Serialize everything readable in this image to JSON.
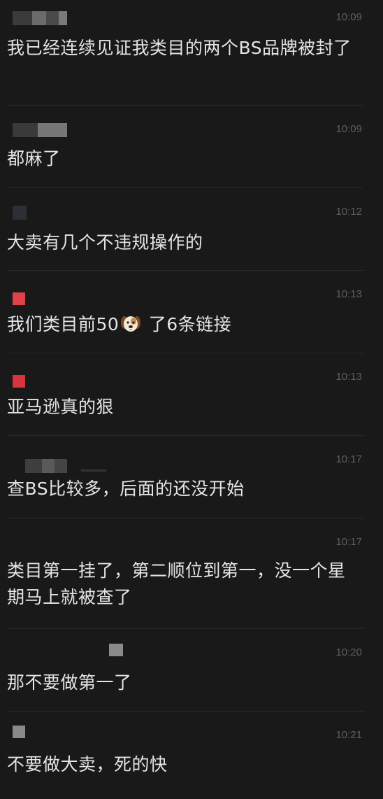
{
  "messages": [
    {
      "time": "10:09",
      "text": "我已经连续见证我类目的两个BS品牌被封了"
    },
    {
      "time": "10:09",
      "text": "都麻了"
    },
    {
      "time": "10:12",
      "text": "大卖有几个不违规操作的"
    },
    {
      "time": "10:13",
      "text_before": "我们类目前50",
      "emoji": "dog-face-emoji",
      "text_after": " 了6条链接"
    },
    {
      "time": "10:13",
      "text": "亚马逊真的狠"
    },
    {
      "time": "10:17",
      "text": "查BS比较多，后面的还没开始"
    },
    {
      "time": "10:17",
      "text": "类目第一挂了，第二顺位到第一，没一个星期马上就被查了"
    },
    {
      "time": "10:20",
      "text": "那不要做第一了"
    },
    {
      "time": "10:21",
      "text": "不要做大卖，死的快"
    }
  ],
  "colors": {
    "background": "#191919",
    "message_text": "#e4e4e4",
    "timestamp": "#5f5f5f",
    "divider": "#2a2a2a",
    "avatar_red": "#e0424a",
    "avatar_gray": "#8a8a8a"
  }
}
